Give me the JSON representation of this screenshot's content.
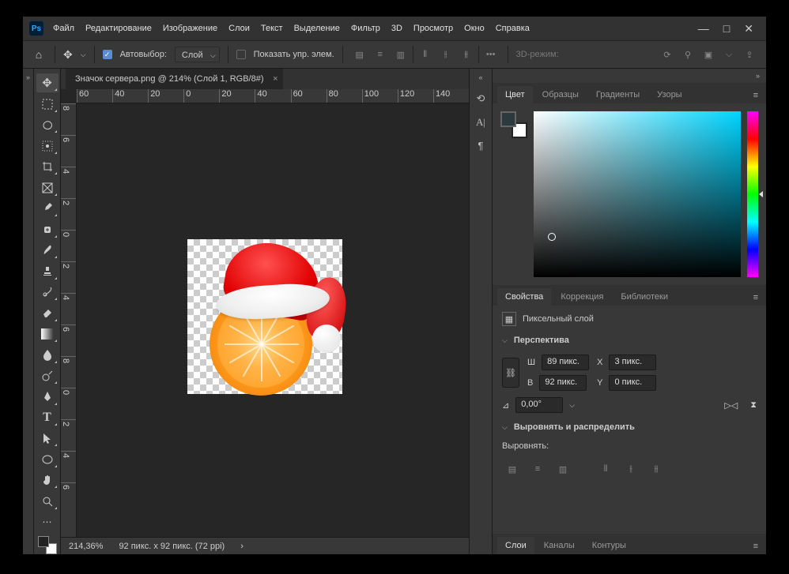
{
  "menu": {
    "file": "Файл",
    "edit": "Редактирование",
    "image": "Изображение",
    "layer": "Слои",
    "type": "Текст",
    "select": "Выделение",
    "filter": "Фильтр",
    "threeD": "3D",
    "view": "Просмотр",
    "window": "Окно",
    "help": "Справка"
  },
  "optbar": {
    "autoselect": "Автовыбор:",
    "layer_dd": "Слой",
    "show_controls": "Показать упр. элем.",
    "mode3d": "3D-режим:"
  },
  "document": {
    "tab": "Значок сервера.png @ 214% (Слой 1, RGB/8#)"
  },
  "ruler_h": [
    "60",
    "40",
    "20",
    "0",
    "20",
    "40",
    "60",
    "80",
    "100",
    "120",
    "140"
  ],
  "ruler_v": [
    "8",
    "6",
    "4",
    "2",
    "0",
    "2",
    "4",
    "6",
    "8",
    "0",
    "2",
    "4",
    "6"
  ],
  "status": {
    "zoom": "214,36%",
    "dims": "92 пикс. x 92 пикс. (72 ppi)"
  },
  "panels": {
    "color_tabs": {
      "color": "Цвет",
      "swatches": "Образцы",
      "gradients": "Градиенты",
      "patterns": "Узоры"
    },
    "props_tabs": {
      "properties": "Свойства",
      "adjust": "Коррекция",
      "libraries": "Библиотеки"
    },
    "props": {
      "kind": "Пиксельный слой",
      "transform": "Перспектива",
      "w_lbl": "Ш",
      "w_val": "89 пикс.",
      "h_lbl": "В",
      "h_val": "92 пикс.",
      "x_lbl": "X",
      "x_val": "3 пикс.",
      "y_lbl": "Y",
      "y_val": "0 пикс.",
      "angle_lbl": "⊿",
      "angle_val": "0,00°",
      "align": "Выровнять и распределить",
      "align_lbl": "Выровнять:"
    },
    "layer_tabs": {
      "layers": "Слои",
      "channels": "Каналы",
      "paths": "Контуры"
    }
  },
  "chart_data": {
    "type": "table",
    "note": "no chart in image"
  }
}
